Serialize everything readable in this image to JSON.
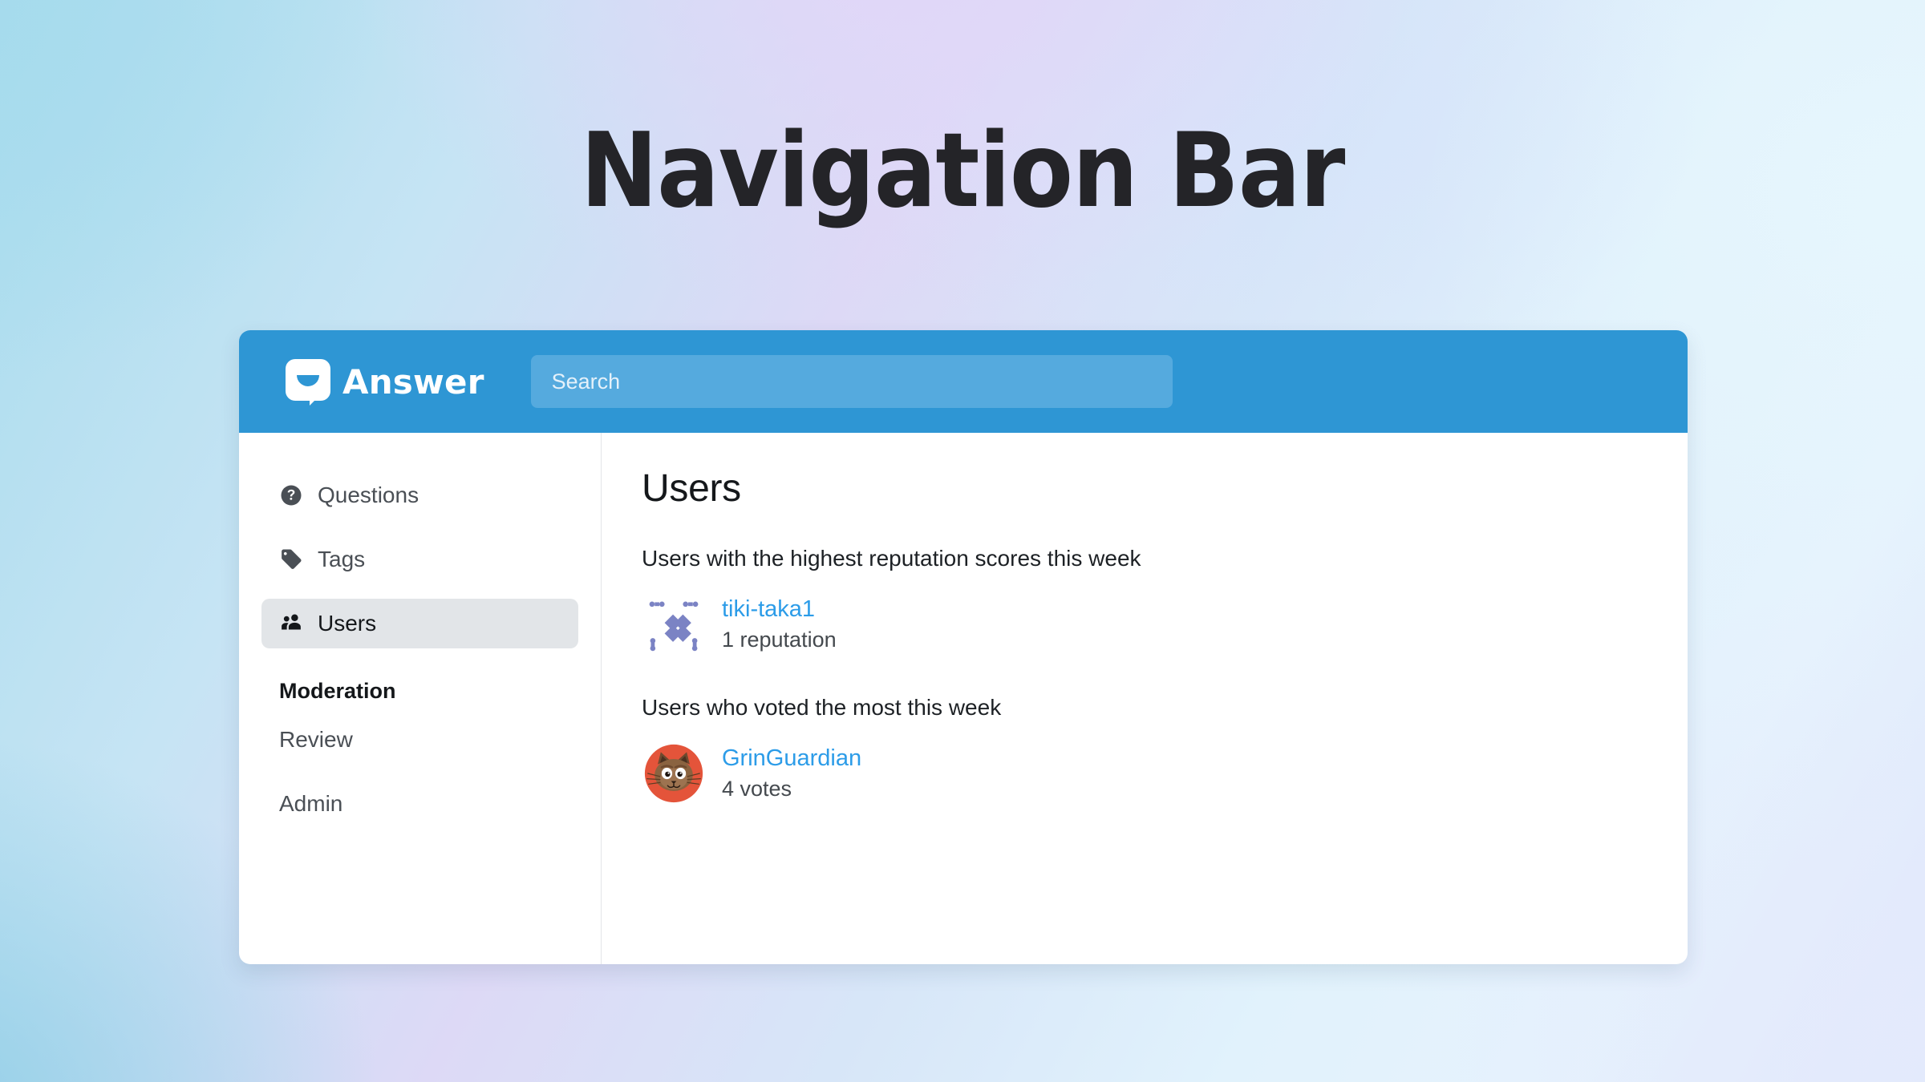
{
  "page": {
    "title": "Navigation Bar",
    "background_colors": {
      "top_left": "#a8dced",
      "top_center": "#ddd9f6",
      "top_right": "#e3f3fc",
      "bottom_left": "#92cfe6",
      "bottom_right": "#dfe7fb"
    }
  },
  "header": {
    "brand_name": "Answer",
    "brand_logo_icon": "speech-bubble-smile-icon",
    "background_color": "#2e96d4",
    "search": {
      "placeholder": "Search",
      "value": "",
      "background_color": "#55aade"
    }
  },
  "sidebar": {
    "items": [
      {
        "label": "Questions",
        "icon": "question-circle-icon",
        "active": false
      },
      {
        "label": "Tags",
        "icon": "tag-icon",
        "active": false
      },
      {
        "label": "Users",
        "icon": "users-icon",
        "active": true
      }
    ],
    "section": {
      "title": "Moderation",
      "items": [
        {
          "label": "Review"
        },
        {
          "label": "Admin"
        }
      ]
    },
    "active_background_color": "#e2e5e8"
  },
  "main": {
    "heading": "Users",
    "sections": [
      {
        "caption": "Users with the highest reputation scores this week",
        "user": {
          "name": "tiki-taka1",
          "stat": "1 reputation",
          "avatar_icon": "identicon-avatar",
          "avatar_color": "#7b83c4"
        }
      },
      {
        "caption": "Users who voted the most this week",
        "user": {
          "name": "GrinGuardian",
          "stat": "4 votes",
          "avatar_icon": "cat-face-avatar",
          "avatar_color": "#e4543a"
        }
      }
    ],
    "link_color": "#2c9ce8"
  }
}
